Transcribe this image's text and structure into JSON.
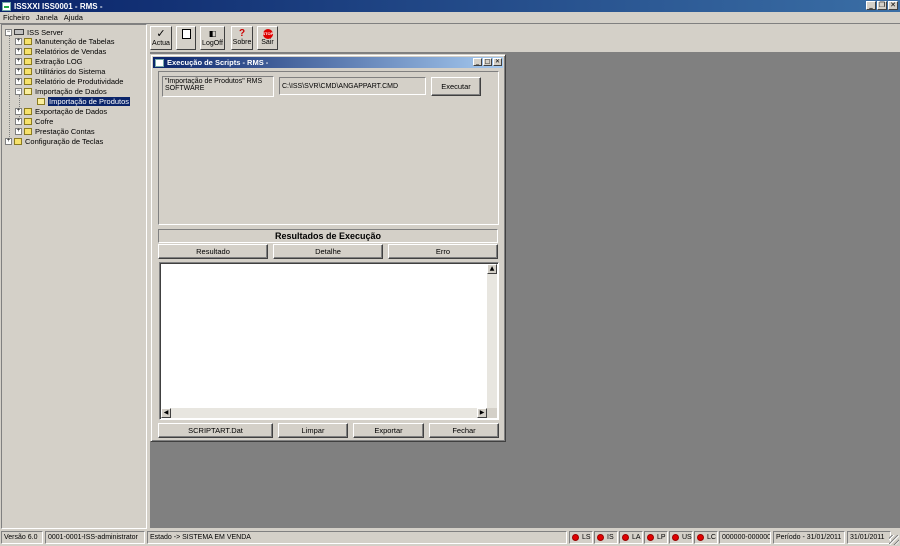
{
  "app": {
    "title": "ISSXXI ISS0001 - RMS -"
  },
  "menu": [
    "Ficheiro",
    "Janela",
    "Ajuda"
  ],
  "tree": {
    "root": "ISS Server",
    "items": [
      "Manutenção de Tabelas",
      "Relatórios de Vendas",
      "Extração LOG",
      "Utilitários do Sistema",
      "Relatório de Produtividade",
      "Importação de Dados",
      "Importação de Produtos",
      "Exportação de Dados",
      "Cofre",
      "Prestação Contas"
    ],
    "root2": "Configuração de Teclas"
  },
  "toolbar": {
    "actua": "Actua",
    "logoff": "LogOff",
    "sobre": "Sobre",
    "sair": "Sair",
    "stop_text": "STOP"
  },
  "child": {
    "title": "Execução de Scripts - RMS -",
    "script_name": "\"Importação de Produtos\" RMS SOFTWARE",
    "script_path": "C:\\ISS\\SVR\\CMD\\ANGAPPART.CMD",
    "execute": "Executar",
    "results_title": "Resultados de Execução",
    "tabs": [
      "Resultado",
      "Detalhe",
      "Erro"
    ],
    "bottom_buttons": [
      "SCRIPTART.Dat",
      "Limpar",
      "Exportar",
      "Fechar"
    ]
  },
  "status": {
    "version": "Versão 6.0",
    "user": "0001-0001-ISS-administrator",
    "state": "Estado -> SISTEMA EM VENDA",
    "leds": [
      "LS",
      "IS",
      "LA",
      "LP",
      "US",
      "LC"
    ],
    "counter": "000000-000000",
    "period": "Período - 31/01/2011",
    "date": "31/01/2011"
  },
  "colors": {
    "titlebar": "#0a246a",
    "led": "#e00000",
    "mdi": "#808080",
    "selection": "#0a246a"
  }
}
